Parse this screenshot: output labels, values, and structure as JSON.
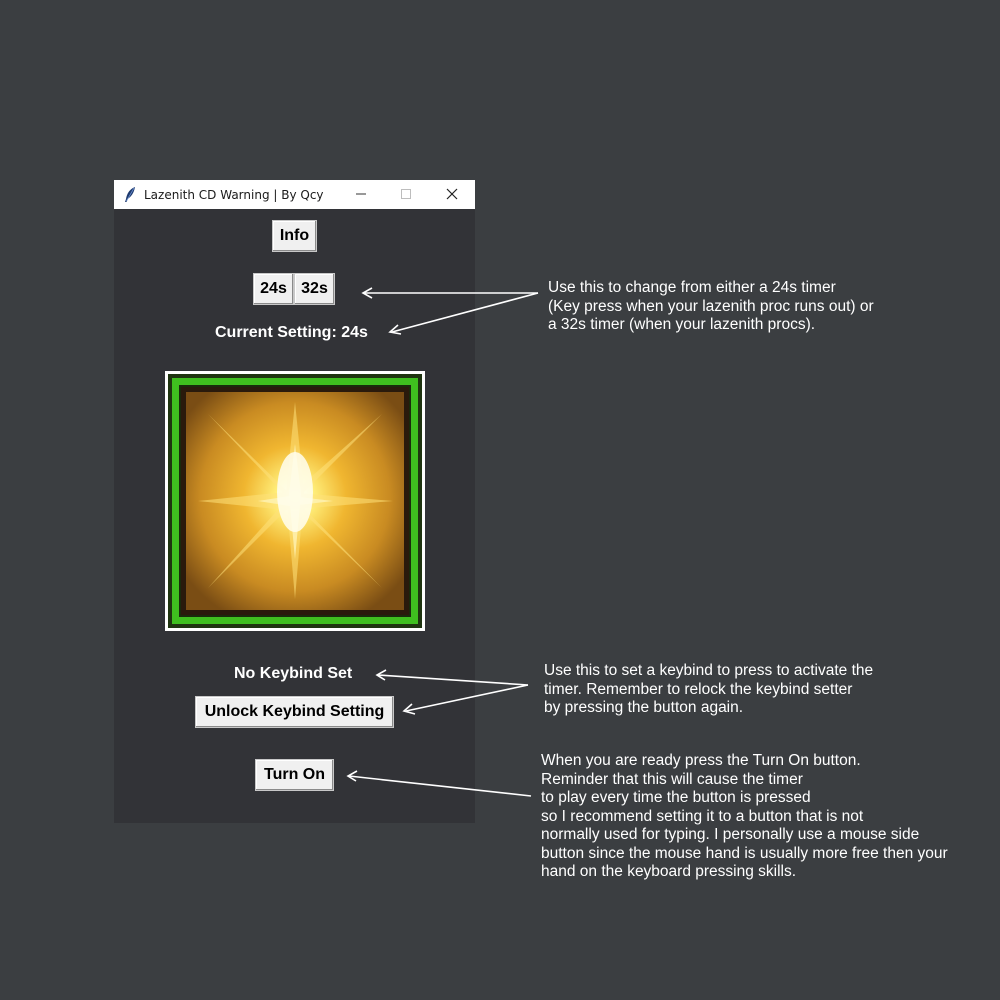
{
  "window": {
    "title": "Lazenith CD Warning | By Qcy",
    "controls": {
      "minimize": "minimize-icon",
      "maximize": "maximize-icon",
      "close": "close-icon"
    }
  },
  "buttons": {
    "info": "Info",
    "timer_24": "24s",
    "timer_32": "32s",
    "unlock_keybind": "Unlock Keybind Setting",
    "turn_on": "Turn On"
  },
  "labels": {
    "current_setting": "Current Setting: 24s",
    "keybind_status": "No Keybind Set"
  },
  "image": {
    "icon": "lazenith-proc-icon",
    "border_color": "#3fbf1f"
  },
  "annotations": {
    "timer": [
      "Use this to change from either a 24s timer",
      "(Key press when your lazenith proc runs out) or",
      "a 32s timer (when your lazenith procs)."
    ],
    "keybind": [
      "Use this to set a keybind to press to activate the",
      "timer. Remember to relock the keybind setter",
      "by pressing the button again."
    ],
    "turn_on": [
      "When you are ready press the Turn On button.",
      "Reminder that this will cause the timer",
      "to play every time the button is pressed",
      "so I recommend setting it to a button that is not",
      "normally used for typing. I personally use a mouse side",
      "button since the mouse hand is usually more free then your",
      "hand on the keyboard pressing skills."
    ]
  },
  "colors": {
    "background": "#3b3e41",
    "window_bg": "#323337",
    "button_bg": "#f0f0f0"
  }
}
